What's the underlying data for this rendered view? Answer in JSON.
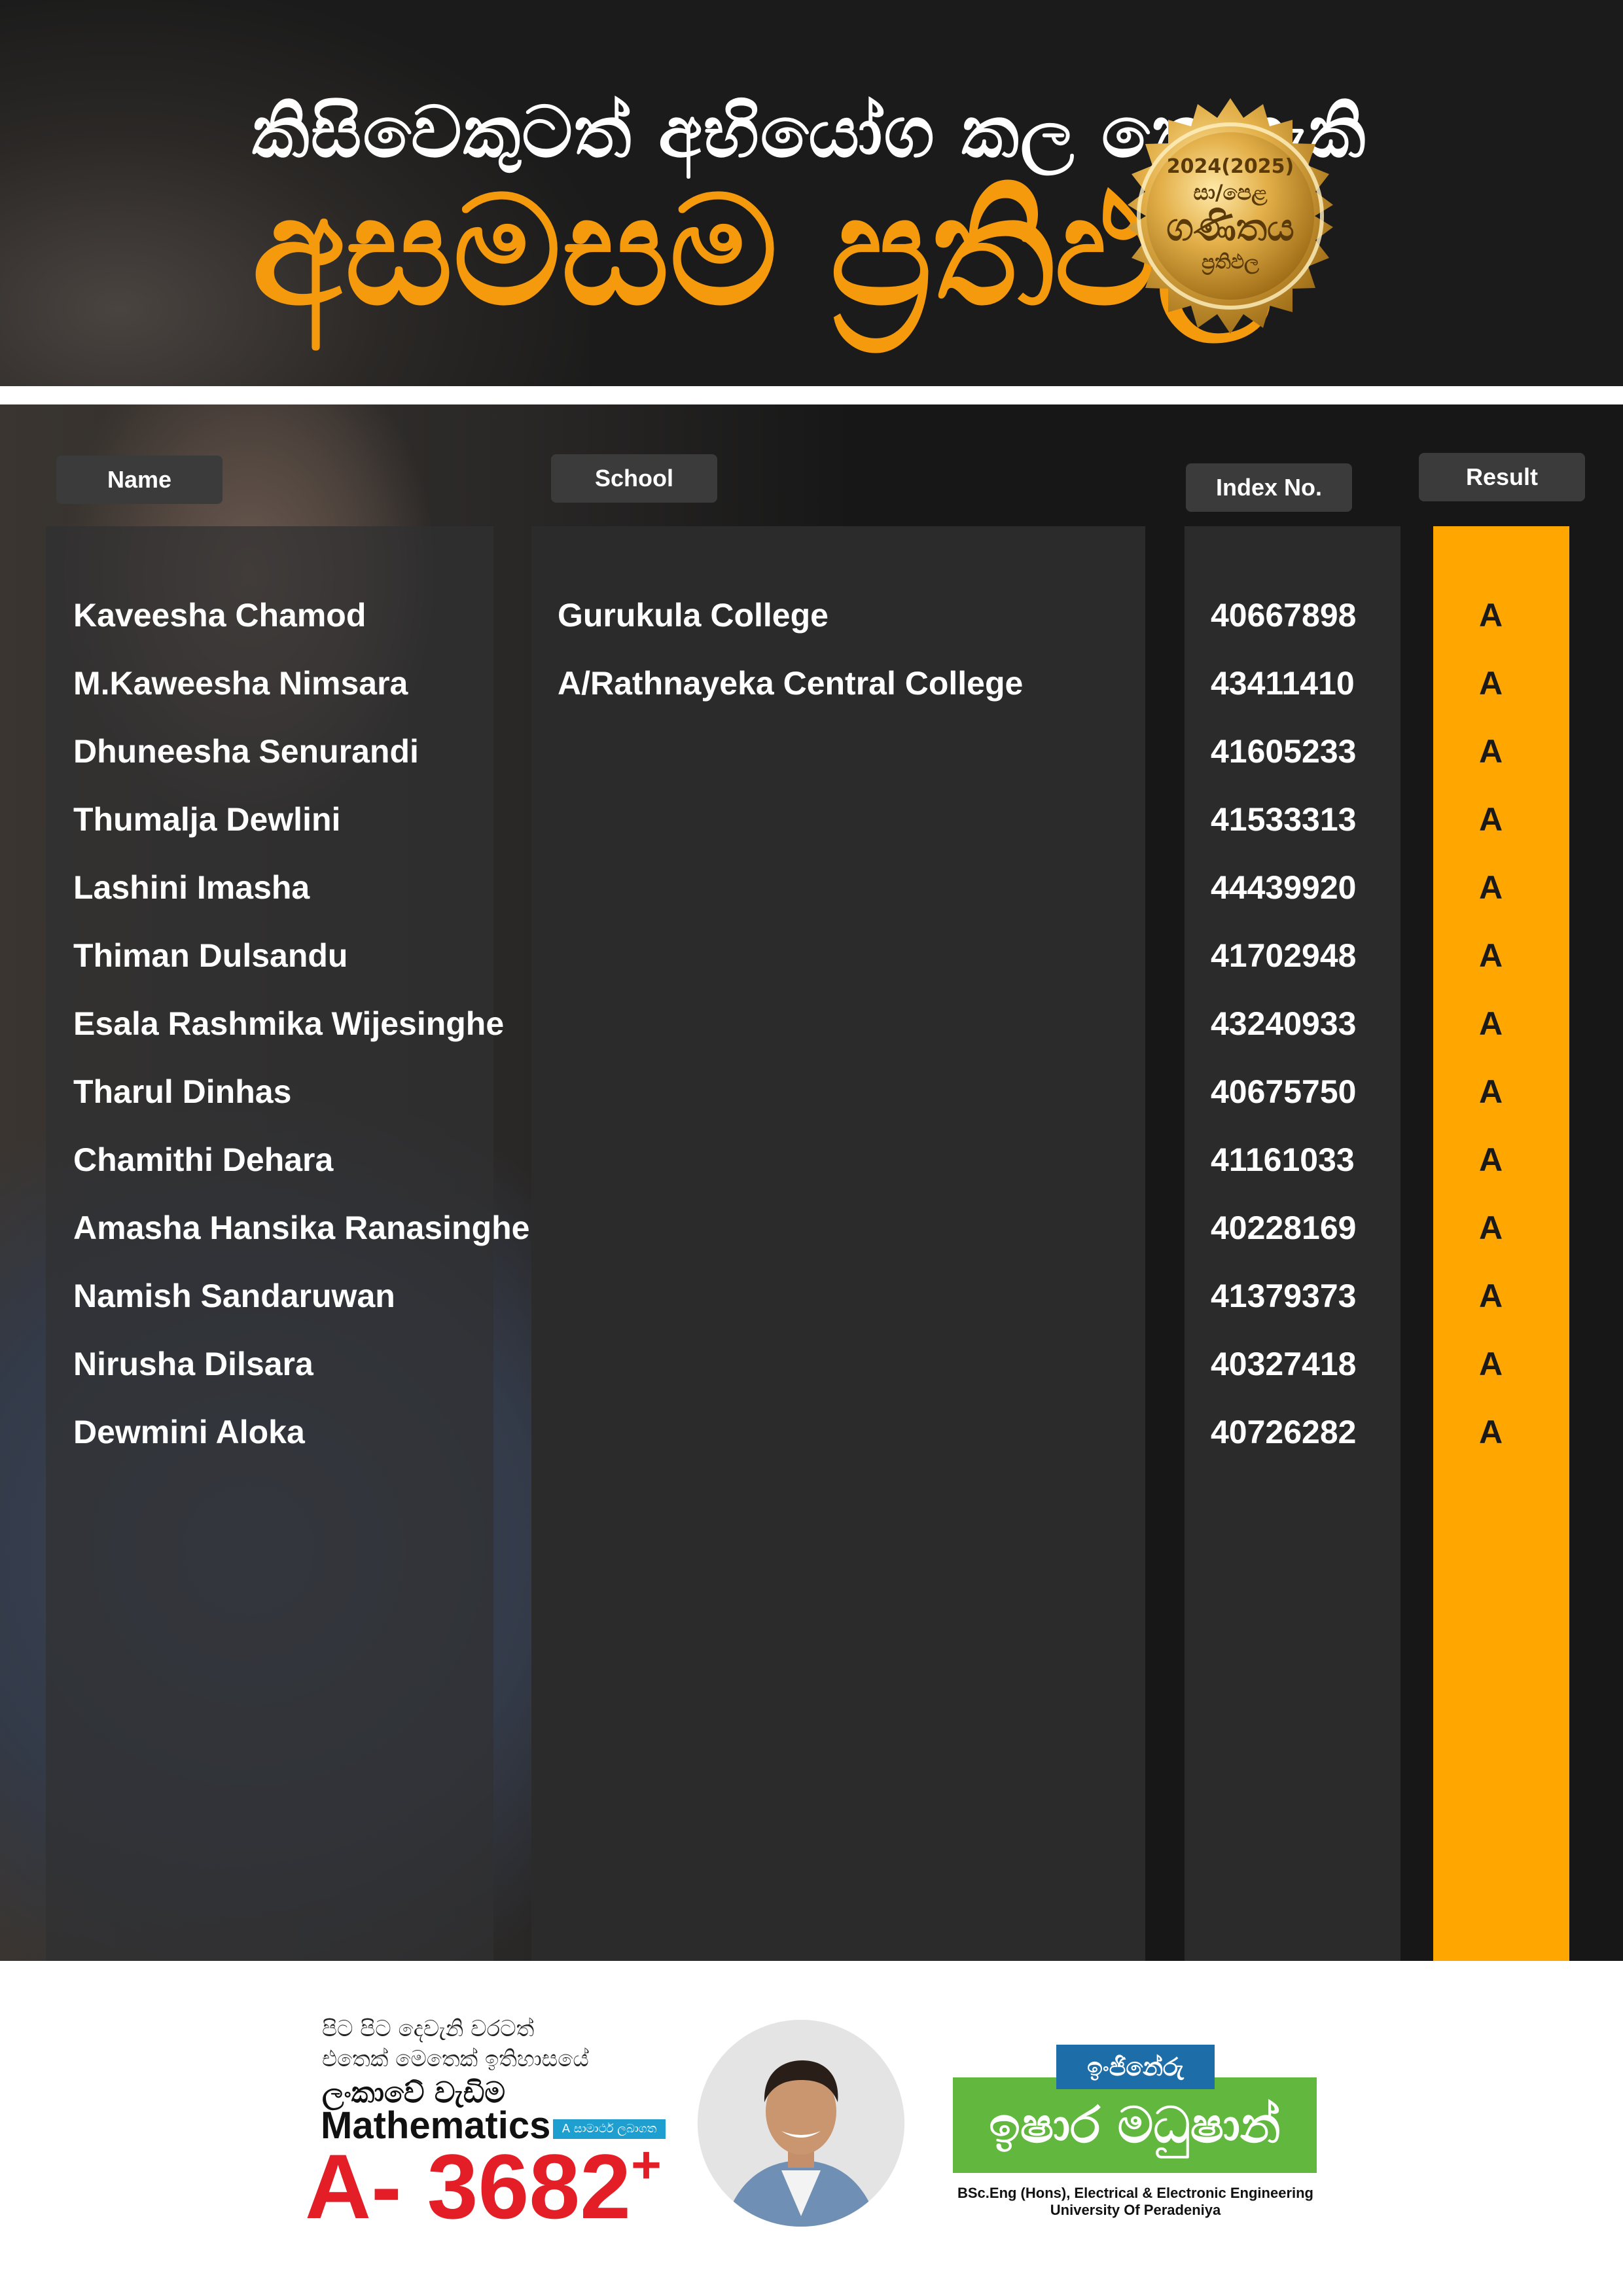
{
  "header": {
    "line1": "කිසිවෙකුටත් අභියෝග කල නොහැකි",
    "line2": "අසමසම ප්‍රතිඵල",
    "seal": {
      "year": "2024(2025)",
      "exam": "සා/පෙළ",
      "subject": "ගණිතය",
      "label": "ප්‍රතිඵල"
    }
  },
  "columns": {
    "name": "Name",
    "school": "School",
    "index": "Index No.",
    "result": "Result"
  },
  "rows": [
    {
      "name": "Kaveesha Chamod",
      "school": "Gurukula College",
      "index": "40667898",
      "result": "A"
    },
    {
      "name": "M.Kaweesha Nimsara",
      "school": "A/Rathnayeka Central College",
      "index": "43411410",
      "result": "A"
    },
    {
      "name": "Dhuneesha Senurandi",
      "school": "",
      "index": "41605233",
      "result": "A"
    },
    {
      "name": "Thumalja Dewlini",
      "school": "",
      "index": "41533313",
      "result": "A"
    },
    {
      "name": "Lashini Imasha",
      "school": "",
      "index": "44439920",
      "result": "A"
    },
    {
      "name": " Thiman Dulsandu",
      "school": "",
      "index": "41702948",
      "result": "A"
    },
    {
      "name": "Esala Rashmika Wijesinghe",
      "school": "",
      "index": "43240933",
      "result": "A"
    },
    {
      "name": " Tharul Dinhas",
      "school": "",
      "index": "40675750",
      "result": "A"
    },
    {
      "name": "Chamithi Dehara",
      "school": "",
      "index": "41161033",
      "result": "A"
    },
    {
      "name": "Amasha Hansika Ranasinghe",
      "school": "",
      "index": "40228169",
      "result": "A"
    },
    {
      "name": "Namish Sandaruwan",
      "school": "",
      "index": "41379373",
      "result": "A"
    },
    {
      "name": "Nirusha Dilsara",
      "school": "",
      "index": "40327418",
      "result": "A"
    },
    {
      "name": " Dewmini Aloka",
      "school": "",
      "index": "40726282",
      "result": "A"
    }
  ],
  "footer": {
    "tagline1": "පිට පිට දෙවැනි වරටත්",
    "tagline2": "එතෙක් මෙතෙක් ඉතිහාසයේ",
    "tagline3": "ලංකාවේ වැඩිම",
    "subject": "Mathematics",
    "badge": "A සාමාර්ථ ලබාගත",
    "count": "A- 3682",
    "count_plus": "+",
    "role": "ඉංජිනේරු",
    "teacher_name": "ඉෂාර මධුෂාන්",
    "degree": "BSc.Eng (Hons), Electrical & Electronic Engineering",
    "university": "University Of Peradeniya"
  },
  "colors": {
    "accent_orange": "#f59a0c",
    "result_column": "#ffa600",
    "count_red": "#e41e26",
    "name_green": "#62b83f",
    "role_blue": "#1d6ea8"
  }
}
